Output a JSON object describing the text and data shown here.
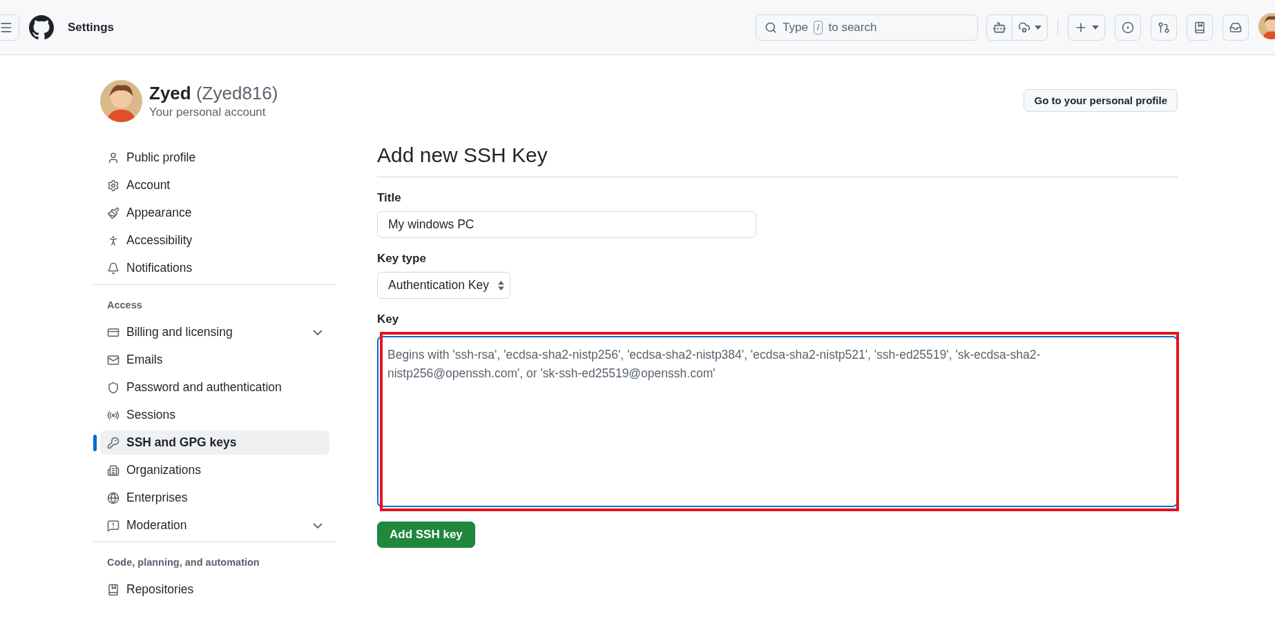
{
  "header": {
    "title": "Settings",
    "search": {
      "placeholder_before": "Type",
      "key": "/",
      "placeholder_after": "to search"
    }
  },
  "account": {
    "name": "Zyed",
    "handle": "(Zyed816)",
    "subtitle": "Your personal account",
    "profile_button": "Go to your personal profile"
  },
  "sidebar": {
    "groups": [
      {
        "items": [
          {
            "label": "Public profile",
            "selected": false,
            "expandable": false
          },
          {
            "label": "Account",
            "selected": false,
            "expandable": false
          },
          {
            "label": "Appearance",
            "selected": false,
            "expandable": false
          },
          {
            "label": "Accessibility",
            "selected": false,
            "expandable": false
          },
          {
            "label": "Notifications",
            "selected": false,
            "expandable": false
          }
        ]
      },
      {
        "heading": "Access",
        "items": [
          {
            "label": "Billing and licensing",
            "selected": false,
            "expandable": true
          },
          {
            "label": "Emails",
            "selected": false,
            "expandable": false
          },
          {
            "label": "Password and authentication",
            "selected": false,
            "expandable": false
          },
          {
            "label": "Sessions",
            "selected": false,
            "expandable": false
          },
          {
            "label": "SSH and GPG keys",
            "selected": true,
            "expandable": false
          },
          {
            "label": "Organizations",
            "selected": false,
            "expandable": false
          },
          {
            "label": "Enterprises",
            "selected": false,
            "expandable": false
          },
          {
            "label": "Moderation",
            "selected": false,
            "expandable": true
          }
        ]
      },
      {
        "heading": "Code, planning, and automation",
        "items": [
          {
            "label": "Repositories",
            "selected": false,
            "expandable": false
          }
        ]
      }
    ]
  },
  "form": {
    "heading": "Add new SSH Key",
    "title_label": "Title",
    "title_value": "My windows PC",
    "key_type_label": "Key type",
    "key_type_value": "Authentication Key",
    "key_label": "Key",
    "key_placeholder": "Begins with 'ssh-rsa', 'ecdsa-sha2-nistp256', 'ecdsa-sha2-nistp384', 'ecdsa-sha2-nistp521', 'ssh-ed25519', 'sk-ecdsa-sha2-nistp256@openssh.com', or 'sk-ssh-ed25519@openssh.com'",
    "key_highlighted": true,
    "submit": "Add SSH key"
  }
}
